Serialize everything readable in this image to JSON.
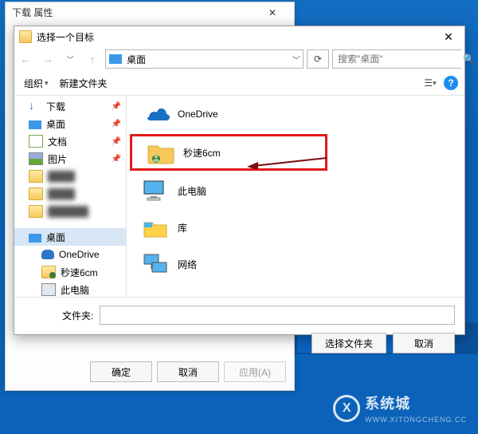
{
  "propertiesWindow": {
    "title": "下载 属性",
    "buttons": {
      "ok": "确定",
      "cancel": "取消",
      "apply": "应用(A)"
    }
  },
  "picker": {
    "title": "选择一个目标",
    "address": "桌面",
    "searchPlaceholder": "搜索\"桌面\"",
    "toolbar": {
      "organize": "组织",
      "newFolder": "新建文件夹"
    },
    "sidebar": {
      "downloads": "下载",
      "desktop": "桌面",
      "documents": "文档",
      "pictures": "图片",
      "desktop2": "桌面",
      "onedrive": "OneDrive",
      "user": "秒速6cm",
      "thispc": "此电脑"
    },
    "items": {
      "onedrive": "OneDrive",
      "user": "秒速6cm",
      "thispc": "此电脑",
      "libraries": "库",
      "network": "网络"
    },
    "folderLabel": "文件夹:",
    "folderValue": "",
    "selectBtn": "选择文件夹",
    "cancelBtn": "取消"
  },
  "watermark": {
    "brand": "系统城",
    "domain": "WWW.XITONGCHENG.CC"
  }
}
